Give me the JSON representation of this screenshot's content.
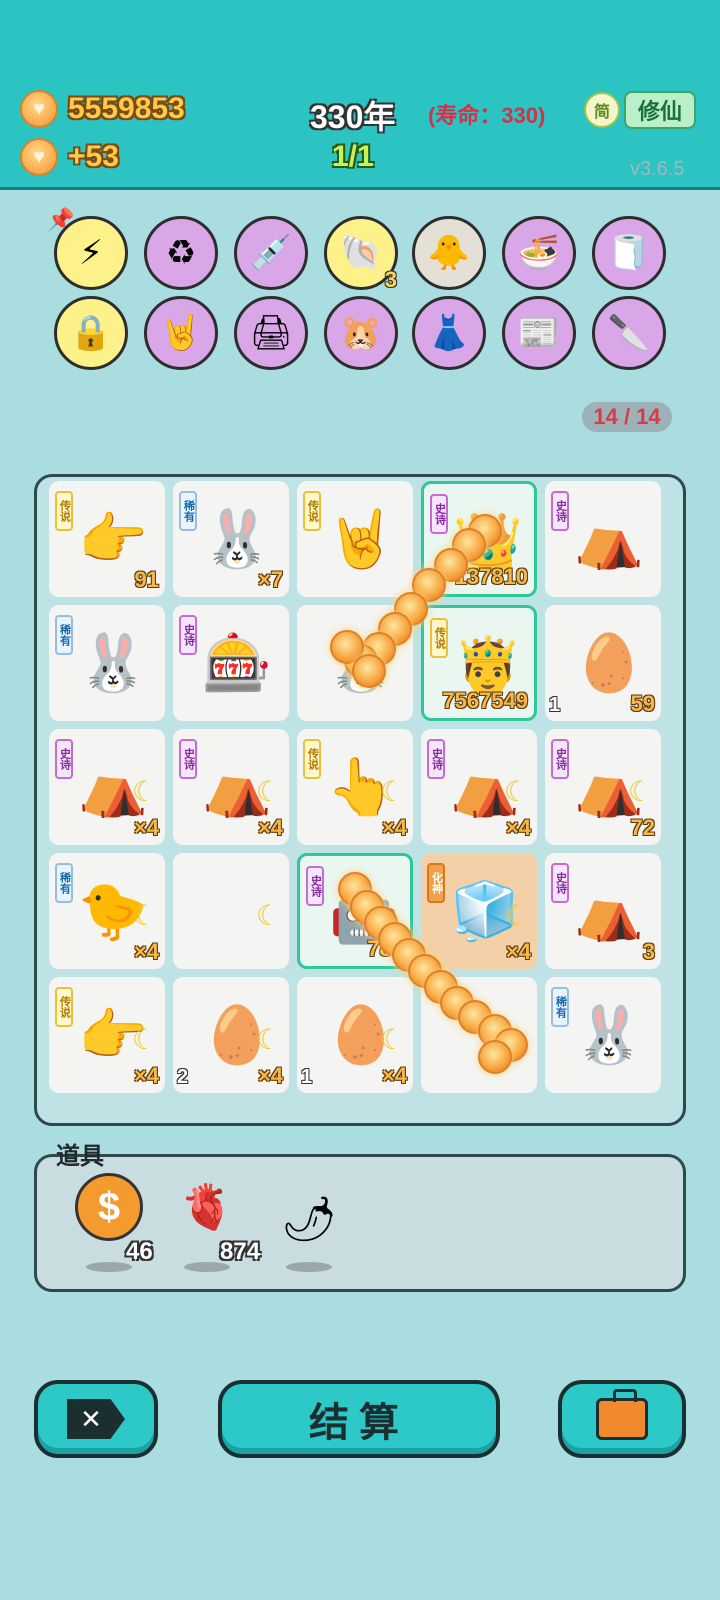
{
  "header": {
    "coins": "5559853",
    "coin_rate": "+53",
    "year": "330年",
    "lifespan": "(寿命：330)",
    "progress": "1/1",
    "simplified_label": "简",
    "cultivate_label": "修仙",
    "version": "v3.6.5"
  },
  "relics": {
    "row1": [
      {
        "icon": "lightning-icon",
        "glyph": "⚡",
        "style": "yellow",
        "pinned": true
      },
      {
        "icon": "recycle-icon",
        "glyph": "♻",
        "style": "purple"
      },
      {
        "icon": "syringe-chick-icon",
        "glyph": "💉",
        "style": "purple"
      },
      {
        "icon": "shell-icon",
        "glyph": "🐚",
        "style": "yellow",
        "count": "3"
      },
      {
        "icon": "chick-egg-icon",
        "glyph": "🐥",
        "style": "grey"
      },
      {
        "icon": "food-bowls-icon",
        "glyph": "🍜",
        "style": "purple"
      },
      {
        "icon": "tissue-box-icon",
        "glyph": "🧻",
        "style": "purple"
      }
    ],
    "row2": [
      {
        "icon": "safe-icon",
        "glyph": "🔒",
        "style": "yellow"
      },
      {
        "icon": "rock-hand-icon",
        "glyph": "🤘",
        "style": "purple"
      },
      {
        "icon": "printer-icon",
        "glyph": "🖨",
        "style": "purple"
      },
      {
        "icon": "meerkats-icon",
        "glyph": "🐹",
        "style": "purple"
      },
      {
        "icon": "skirt-icon",
        "glyph": "👗",
        "style": "purple"
      },
      {
        "icon": "time-magazine-icon",
        "glyph": "📰",
        "style": "purple"
      },
      {
        "icon": "cleaver-icon",
        "glyph": "🔪",
        "style": "purple"
      }
    ]
  },
  "page_indicator": "14 / 14",
  "board": {
    "rows": [
      [
        {
          "rarity": "传说",
          "rtype": "legend",
          "art": "👉",
          "icon": "pointing-hand-icon",
          "num": "91"
        },
        {
          "rarity": "稀有",
          "rtype": "rare",
          "art": "🐰",
          "icon": "rabbit-icon",
          "num": "×7"
        },
        {
          "rarity": "传说",
          "rtype": "legend",
          "art": "🤘",
          "icon": "rock-hand-icon",
          "num": ""
        },
        {
          "rarity": "史诗",
          "rtype": "epic",
          "art": "👑",
          "icon": "crowned-robot-icon",
          "num": "137810",
          "hl": true
        },
        {
          "rarity": "史诗",
          "rtype": "epic",
          "art": "⛺",
          "icon": "rabbit-tent-icon",
          "num": ""
        }
      ],
      [
        {
          "rarity": "稀有",
          "rtype": "rare",
          "art": "🐰",
          "icon": "rabbit-icon",
          "num": ""
        },
        {
          "rarity": "史诗",
          "rtype": "epic",
          "art": "🎰",
          "icon": "gacha-machine-icon",
          "num": ""
        },
        {
          "rarity": "",
          "rtype": "",
          "art": "🐰",
          "icon": "rabbit-icon",
          "num": ""
        },
        {
          "rarity": "传说",
          "rtype": "legend",
          "art": "🤴",
          "icon": "king-face-icon",
          "num": "7567549",
          "hl": true
        },
        {
          "rarity": "",
          "rtype": "",
          "art": "🥚",
          "icon": "egg-icon",
          "num": "59",
          "left": "1"
        }
      ],
      [
        {
          "rarity": "史诗",
          "rtype": "epic",
          "art": "⛺",
          "icon": "rabbit-tent-icon",
          "num": "×4",
          "moon": true
        },
        {
          "rarity": "史诗",
          "rtype": "epic",
          "art": "⛺",
          "icon": "rabbit-tent-icon",
          "num": "×4",
          "moon": true
        },
        {
          "rarity": "传说",
          "rtype": "legend",
          "art": "👆",
          "icon": "pointing-up-hand-icon",
          "num": "×4",
          "moon": true
        },
        {
          "rarity": "史诗",
          "rtype": "epic",
          "art": "⛺",
          "icon": "rabbit-tent-icon",
          "num": "×4",
          "moon": true
        },
        {
          "rarity": "史诗",
          "rtype": "epic",
          "art": "⛺",
          "icon": "rabbit-tent-icon",
          "num": "72",
          "moon": true
        }
      ],
      [
        {
          "rarity": "稀有",
          "rtype": "rare",
          "art": "🐤",
          "icon": "chick-icon",
          "num": "×4",
          "moon": true
        },
        {
          "rarity": "",
          "rtype": "",
          "art": "",
          "icon": "moon-icon",
          "num": "",
          "moon": true
        },
        {
          "rarity": "史诗",
          "rtype": "epic",
          "art": "🤖",
          "icon": "robot-icon",
          "num": "781",
          "hl": true
        },
        {
          "rarity": "化神",
          "rtype": "god",
          "art": "🧊",
          "icon": "fridge-icon",
          "num": "×4",
          "moon": true,
          "orange": true
        },
        {
          "rarity": "史诗",
          "rtype": "epic",
          "art": "⛺",
          "icon": "rabbit-tent-icon",
          "num": "3"
        }
      ],
      [
        {
          "rarity": "传说",
          "rtype": "legend",
          "art": "👉",
          "icon": "pointing-hand-icon",
          "num": "×4",
          "moon": true
        },
        {
          "rarity": "",
          "rtype": "",
          "art": "🥚",
          "icon": "egg-icon",
          "num": "×4",
          "left": "2",
          "moon": true
        },
        {
          "rarity": "",
          "rtype": "",
          "art": "🥚",
          "icon": "egg-icon",
          "num": "×4",
          "left": "1",
          "moon": true
        },
        {
          "rarity": "",
          "rtype": "",
          "art": "",
          "icon": "moon-icon",
          "num": "",
          "moon": true
        },
        {
          "rarity": "稀有",
          "rtype": "rare",
          "art": "🐰",
          "icon": "rabbit-icon",
          "num": ""
        }
      ]
    ]
  },
  "props": {
    "title": "道具",
    "items": [
      {
        "icon": "dollar-coin-icon",
        "count": "46"
      },
      {
        "icon": "liver-icon",
        "glyph": "🫀",
        "count": "874"
      },
      {
        "icon": "chili-pepper-icon",
        "glyph": "🌶",
        "count": ""
      }
    ]
  },
  "footer": {
    "exit_glyph": "✕",
    "settle_label": "结算"
  }
}
